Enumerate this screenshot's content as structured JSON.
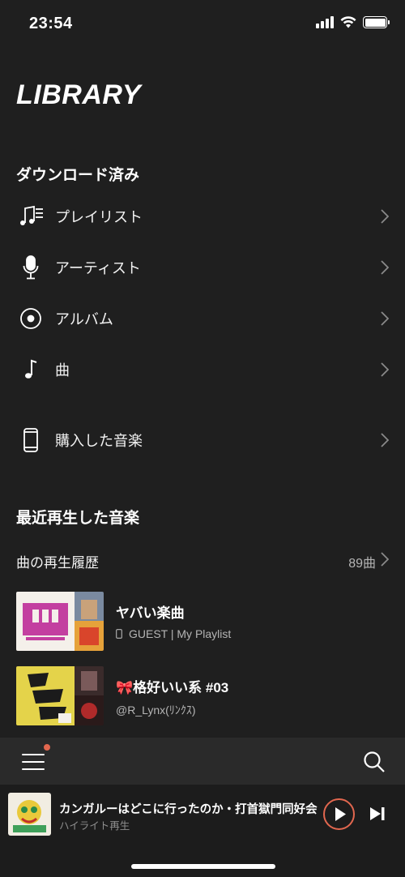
{
  "status_bar": {
    "time": "23:54"
  },
  "header": {
    "title": "LIBRARY"
  },
  "downloaded": {
    "section_title": "ダウンロード済み",
    "items": [
      {
        "label": "プレイリスト",
        "icon": "playlist-icon"
      },
      {
        "label": "アーティスト",
        "icon": "microphone-icon"
      },
      {
        "label": "アルバム",
        "icon": "disc-icon"
      },
      {
        "label": "曲",
        "icon": "music-note-icon"
      }
    ]
  },
  "purchased": {
    "label": "購入した音楽",
    "icon": "phone-icon"
  },
  "recent": {
    "section_title": "最近再生した音楽",
    "history_label": "曲の再生履歴",
    "history_count": "89曲",
    "playlists": [
      {
        "title": "ヤバい楽曲",
        "subtitle": "GUEST | My Playlist"
      },
      {
        "title": "🎀格好いい系 #03",
        "subtitle": "@R_Lynx(ﾘﾝｸｽ)"
      }
    ]
  },
  "mini_player": {
    "title": "カンガルーはどこに行ったのか・打首獄門同好会",
    "subtitle": "ハイライト再生"
  },
  "colors": {
    "accent": "#e2674f",
    "background": "#1f1f1f"
  }
}
